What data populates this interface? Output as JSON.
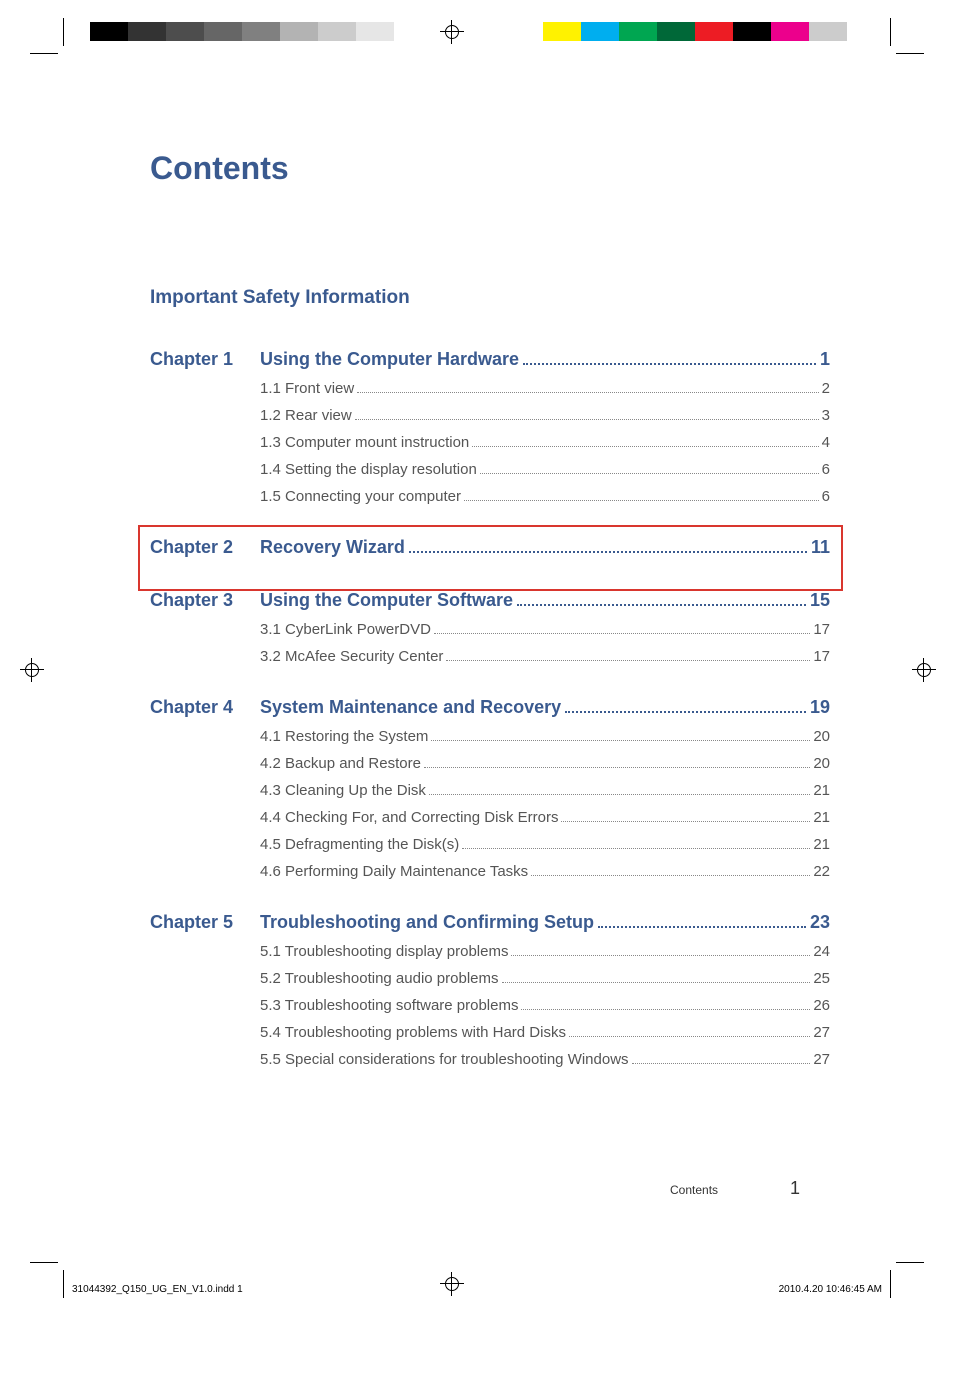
{
  "title": "Contents",
  "intro_heading": "Important Safety Information",
  "chapters": [
    {
      "label": "Chapter 1",
      "title": "Using the Computer Hardware",
      "page": "1",
      "subs": [
        {
          "text": "1.1 Front view",
          "page": "2"
        },
        {
          "text": "1.2 Rear view",
          "page": "3"
        },
        {
          "text": "1.3 Computer mount instruction",
          "page": "4"
        },
        {
          "text": "1.4 Setting the display resolution",
          "page": "6"
        },
        {
          "text": "1.5 Connecting your computer",
          "page": "6"
        }
      ]
    },
    {
      "label": "Chapter 2",
      "title": "Recovery Wizard",
      "page": "11",
      "subs": []
    },
    {
      "label": "Chapter 3",
      "title": "Using the Computer Software",
      "page": "15",
      "subs": [
        {
          "text": "3.1 CyberLink PowerDVD",
          "page": "17"
        },
        {
          "text": "3.2 McAfee Security Center",
          "page": "17"
        }
      ]
    },
    {
      "label": "Chapter 4",
      "title": "System Maintenance and Recovery",
      "page": "19",
      "subs": [
        {
          "text": "4.1 Restoring the System",
          "page": "20"
        },
        {
          "text": "4.2 Backup and Restore",
          "page": "20"
        },
        {
          "text": "4.3 Cleaning Up the Disk",
          "page": "21"
        },
        {
          "text": "4.4 Checking For, and Correcting Disk Errors",
          "page": "21"
        },
        {
          "text": "4.5 Defragmenting the Disk(s)",
          "page": "21"
        },
        {
          "text": "4.6 Performing Daily Maintenance Tasks",
          "page": "22"
        }
      ]
    },
    {
      "label": "Chapter 5",
      "title": "Troubleshooting and Confirming Setup",
      "page": "23",
      "subs": [
        {
          "text": "5.1 Troubleshooting display problems",
          "page": "24"
        },
        {
          "text": "5.2 Troubleshooting audio problems",
          "page": "25"
        },
        {
          "text": "5.3 Troubleshooting software problems",
          "page": "26"
        },
        {
          "text": "5.4 Troubleshooting problems with Hard Disks",
          "page": "27"
        },
        {
          "text": "5.5 Special considerations for troubleshooting Windows",
          "page": "27"
        }
      ]
    }
  ],
  "footer_label": "Contents",
  "footer_page": "1",
  "slug_left": "31044392_Q150_UG_EN_V1.0.indd   1",
  "slug_right": "2010.4.20   10:46:45 AM"
}
